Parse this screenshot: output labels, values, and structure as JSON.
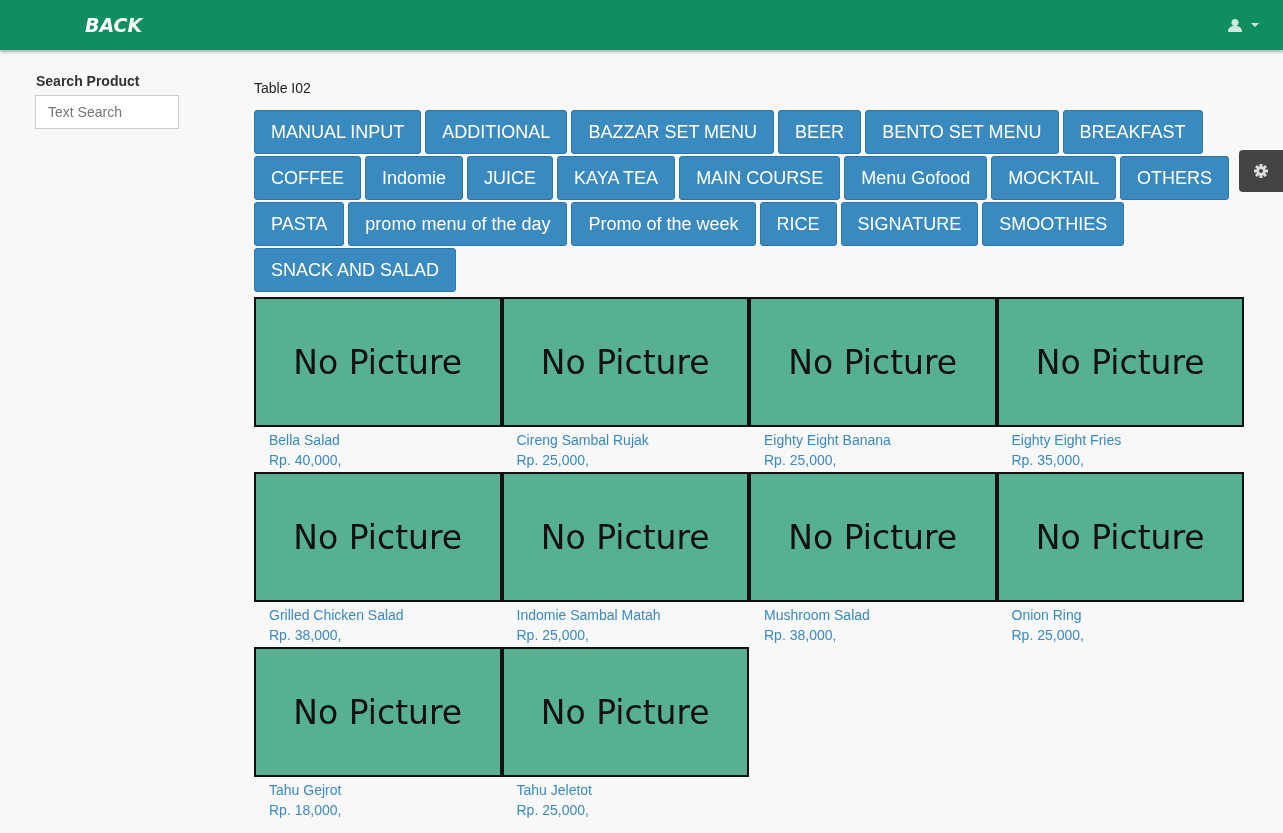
{
  "navbar": {
    "back": "BACK"
  },
  "sidebar": {
    "label": "Search Product",
    "search": {
      "placeholder": "Text Search"
    }
  },
  "table_label": "Table I02",
  "categories": [
    "MANUAL INPUT",
    "ADDITIONAL",
    "BAZZAR SET MENU",
    "BEER",
    "BENTO SET MENU",
    "BREAKFAST",
    "COFFEE",
    "Indomie",
    "JUICE",
    "KAYA TEA",
    "MAIN COURSE",
    "Menu Gofood",
    "MOCKTAIL",
    "OTHERS",
    "PASTA",
    "promo menu of the day",
    "Promo of the week",
    "RICE",
    "SIGNATURE",
    "SMOOTHIES",
    "SNACK AND SALAD"
  ],
  "products": [
    {
      "image_text": "No Picture",
      "name": "Bella Salad",
      "price": "Rp. 40,000,"
    },
    {
      "image_text": "No Picture",
      "name": "Cireng Sambal Rujak",
      "price": "Rp. 25,000,"
    },
    {
      "image_text": "No Picture",
      "name": "Eighty Eight Banana",
      "price": "Rp. 25,000,"
    },
    {
      "image_text": "No Picture",
      "name": "Eighty Eight Fries",
      "price": "Rp. 35,000,"
    },
    {
      "image_text": "No Picture",
      "name": "Grilled Chicken Salad",
      "price": "Rp. 38,000,"
    },
    {
      "image_text": "No Picture",
      "name": "Indomie Sambal Matah",
      "price": "Rp. 25,000,"
    },
    {
      "image_text": "No Picture",
      "name": "Mushroom Salad",
      "price": "Rp. 38,000,"
    },
    {
      "image_text": "No Picture",
      "name": "Onion Ring",
      "price": "Rp. 25,000,"
    },
    {
      "image_text": "No Picture",
      "name": "Tahu Gejrot",
      "price": "Rp. 18,000,"
    },
    {
      "image_text": "No Picture",
      "name": "Tahu Jeletot",
      "price": "Rp. 25,000,"
    }
  ]
}
